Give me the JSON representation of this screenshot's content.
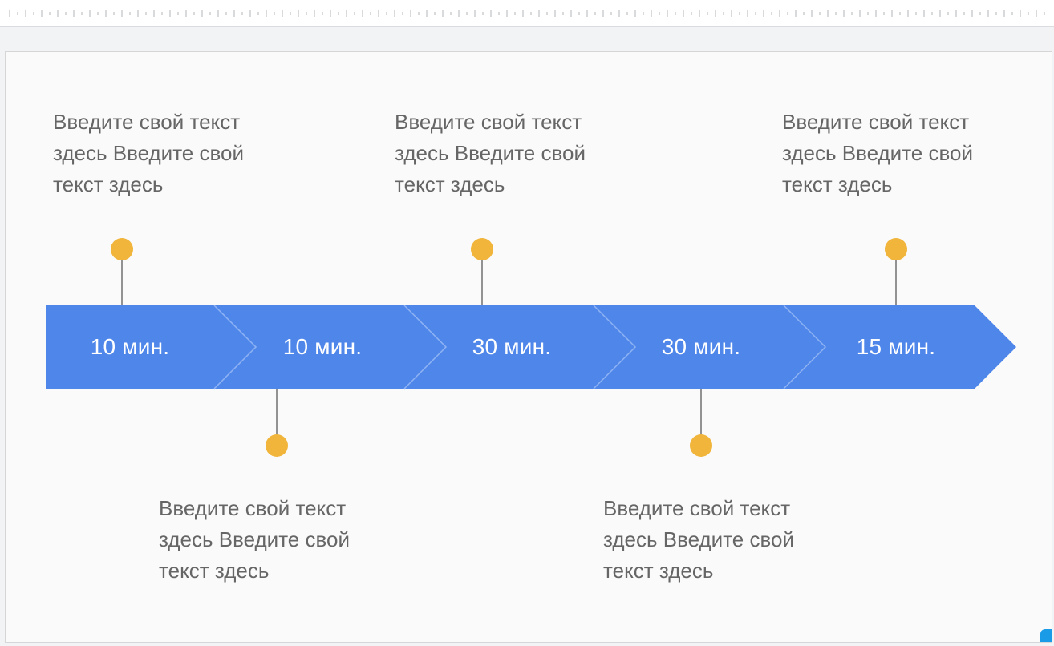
{
  "colors": {
    "arrow": "#4f86ea",
    "divider": "#8fb3f3",
    "pin": "#f0b53a",
    "stem": "#707070",
    "note_text": "#666666",
    "slide_bg": "#fafafa"
  },
  "timeline": {
    "steps": [
      {
        "label": "10 мин."
      },
      {
        "label": "10 мин."
      },
      {
        "label": "30 мин."
      },
      {
        "label": "30 мин."
      },
      {
        "label": "15 мин."
      }
    ],
    "notes_top": [
      {
        "text": "Введите свой текст здесь Введите свой текст здесь"
      },
      {
        "text": "Введите свой текст здесь Введите свой текст здесь"
      },
      {
        "text": "Введите свой текст здесь Введите свой текст здесь"
      }
    ],
    "notes_bottom": [
      {
        "text": "Введите свой текст здесь Введите свой текст здесь"
      },
      {
        "text": "Введите свой текст здесь Введите свой текст здесь"
      }
    ]
  }
}
